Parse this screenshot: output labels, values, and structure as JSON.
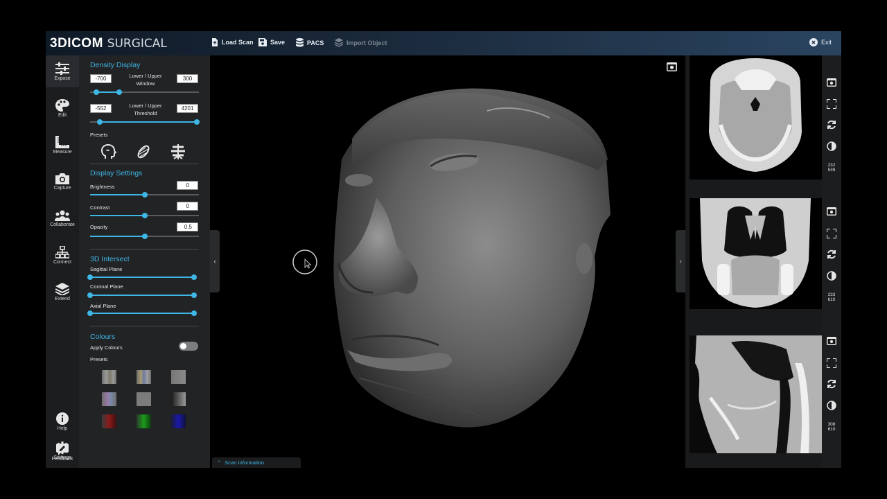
{
  "app": {
    "logo_bold": "3D",
    "logo_mid": "I",
    "logo_bold2": "COM",
    "logo_light": "SURGICAL"
  },
  "toolbar": {
    "load_scan": "Load Scan",
    "save": "Save",
    "pacs": "PACS",
    "import_object": "Import Object",
    "exit": "Exit"
  },
  "nav": [
    {
      "label": "Expose",
      "icon": "sliders-icon",
      "active": true
    },
    {
      "label": "Edit",
      "icon": "palette-icon"
    },
    {
      "label": "Measure",
      "icon": "ruler-icon"
    },
    {
      "label": "Capture",
      "icon": "camera-icon"
    },
    {
      "label": "Collaborate",
      "icon": "users-icon"
    },
    {
      "label": "Connect",
      "icon": "network-icon"
    },
    {
      "label": "Extend",
      "icon": "layers-icon"
    }
  ],
  "nav_bottom": [
    {
      "label": "Help",
      "icon": "info-icon"
    },
    {
      "label": "Settings",
      "icon": "gear-icon"
    },
    {
      "label": "Feedback",
      "icon": "feedback-icon"
    }
  ],
  "density": {
    "title": "Density Display",
    "window_label_1": "Lower / Upper",
    "window_label_2": "Window",
    "window_lower": "-700",
    "window_upper": "300",
    "threshold_label_1": "Lower / Upper",
    "threshold_label_2": "Threshold",
    "threshold_lower": "-552",
    "threshold_upper": "4201",
    "window_range": [
      0.06,
      0.27
    ],
    "threshold_range": [
      0.09,
      0.98
    ],
    "presets_label": "Presets",
    "preset_icons": [
      "head-icon",
      "muscle-icon",
      "spine-icon"
    ]
  },
  "display": {
    "title": "Display Settings",
    "brightness_label": "Brightness",
    "brightness": "0",
    "brightness_level": 0.5,
    "contrast_label": "Contrast",
    "contrast": "0",
    "contrast_level": 0.5,
    "opacity_label": "Opacity",
    "opacity": "0.5",
    "opacity_level": 0.5
  },
  "intersect": {
    "title": "3D Intersect",
    "sagittal": "Sagittal Plane",
    "coronal": "Coronal Plane",
    "axial": "Axial Plane",
    "sagittal_range": [
      0,
      1
    ],
    "coronal_range": [
      0,
      1
    ],
    "axial_range": [
      0,
      1
    ]
  },
  "colours": {
    "title": "Colours",
    "apply_label": "Apply Colours",
    "apply_on": false,
    "presets_label": "Presets",
    "swatches": [
      [
        "#8a8a8a",
        "#9a8a70",
        "#7a8aa0"
      ],
      [
        "#7a7a7a",
        "#8b8a9a",
        "#6f6f6f"
      ],
      [
        "#7a7a7a",
        "#8a70a0",
        "#5a5a5a"
      ],
      [
        "#707070",
        "#7c7c7c",
        "#3a3a3a"
      ],
      [
        "#8c1a1a",
        "#1a8c1a",
        "#1a1a9c"
      ]
    ]
  },
  "viewport": {
    "scan_information": "Scan Information"
  },
  "slices": [
    {
      "view": "axial",
      "min": "0",
      "max": "539",
      "level": 0.41,
      "counter_top": "232",
      "counter_bottom": "539"
    },
    {
      "view": "coronal",
      "min": "0",
      "max": "610",
      "level": 0.39,
      "counter_top": "233",
      "counter_bottom": "610"
    },
    {
      "view": "sagittal",
      "min": "0",
      "max": "610",
      "level": 0.5,
      "counter_top": "308",
      "counter_bottom": "610"
    }
  ],
  "colors": {
    "accent": "#3eb6e6",
    "panel": "#222325",
    "topbar": "#1b2a3c"
  }
}
